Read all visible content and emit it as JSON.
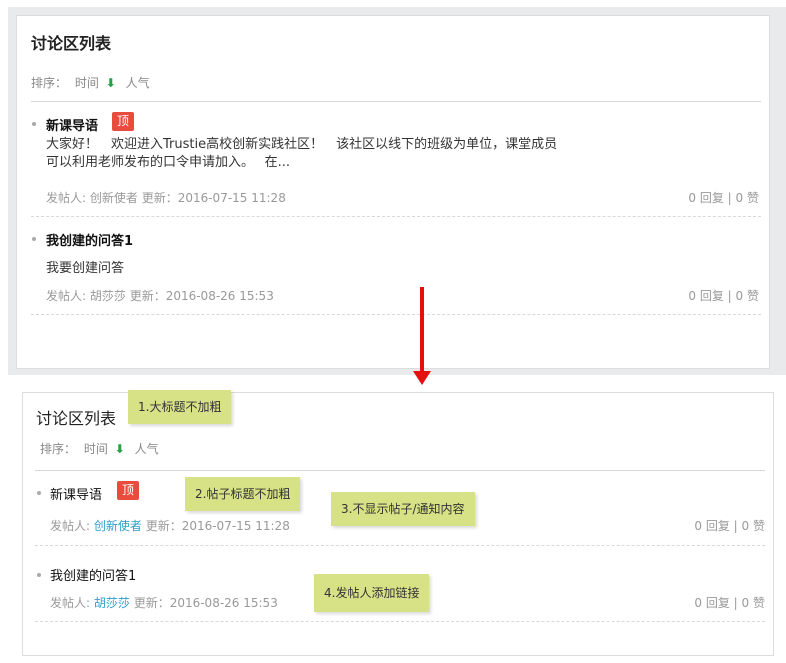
{
  "top": {
    "title": "讨论区列表",
    "sort_label": "排序：",
    "sort_time": "时间",
    "sort_arrow": "⬇",
    "sort_popular": "人气",
    "posts": [
      {
        "title": "新课导语",
        "badge": "顶",
        "body_line1": "大家好！　欢迎进入Trustie高校创新实践社区！　该社区以线下的班级为单位，课堂成员",
        "body_line2": "可以利用老师发布的口令申请加入。　 在...",
        "meta_prefix": "发帖人: ",
        "author": "创新使者",
        "meta_update": " 更新：2016-07-15 11:28",
        "stats": "0 回复 | 0 赞"
      },
      {
        "title": "我创建的问答1",
        "body_line1": "我要创建问答",
        "meta_prefix": "发帖人: ",
        "author": "胡莎莎",
        "meta_update": " 更新：2016-08-26 15:53",
        "stats": "0 回复 | 0 赞"
      }
    ]
  },
  "bottom": {
    "title": "讨论区列表",
    "sort_label": "排序：",
    "sort_time": "时间",
    "sort_arrow": "⬇",
    "sort_popular": "人气",
    "posts": [
      {
        "title": "新课导语",
        "badge": "顶",
        "meta_prefix": "发帖人: ",
        "author": "创新使者",
        "meta_update": " 更新：2016-07-15 11:28",
        "stats": "0 回复 | 0 赞"
      },
      {
        "title": "我创建的问答1",
        "meta_prefix": "发帖人: ",
        "author": "胡莎莎",
        "meta_update": " 更新：2016-08-26 15:53",
        "stats": "0 回复 | 0 赞"
      }
    ]
  },
  "notes": {
    "n1": "1.大标题不加粗",
    "n2": "2.帖子标题不加粗",
    "n3": "3.不显示帖子/通知内容",
    "n4": "4.发帖人添加链接"
  },
  "colors": {
    "arrow": "#e40f0f",
    "badge": "#e84c3d",
    "note_bg": "#d6e285",
    "link": "#2ba0c8",
    "sort_arrow": "#25a047"
  }
}
